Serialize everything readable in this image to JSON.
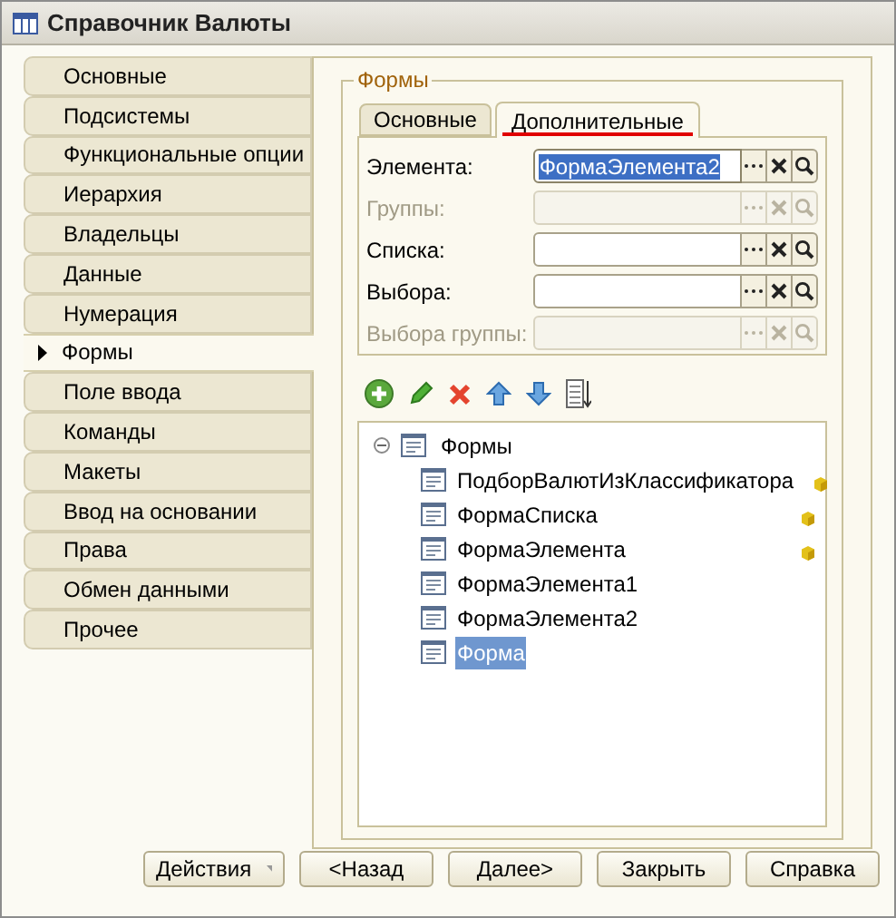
{
  "window": {
    "title": "Справочник Валюты"
  },
  "sections": [
    {
      "label": "Основные",
      "selected": false
    },
    {
      "label": "Подсистемы",
      "selected": false
    },
    {
      "label": "Функциональные опции",
      "selected": false
    },
    {
      "label": "Иерархия",
      "selected": false
    },
    {
      "label": "Владельцы",
      "selected": false
    },
    {
      "label": "Данные",
      "selected": false
    },
    {
      "label": "Нумерация",
      "selected": false
    },
    {
      "label": "Формы",
      "selected": true
    },
    {
      "label": "Поле ввода",
      "selected": false
    },
    {
      "label": "Команды",
      "selected": false
    },
    {
      "label": "Макеты",
      "selected": false
    },
    {
      "label": "Ввод на основании",
      "selected": false
    },
    {
      "label": "Права",
      "selected": false
    },
    {
      "label": "Обмен данными",
      "selected": false
    },
    {
      "label": "Прочее",
      "selected": false
    }
  ],
  "group": {
    "title": "Формы",
    "tabs": [
      {
        "label": "Основные",
        "selected": false
      },
      {
        "label": "Дополнительные",
        "selected": true
      }
    ],
    "fields": [
      {
        "label": "Элемента:",
        "value": "ФормаЭлемента2",
        "disabled": false,
        "selected": true
      },
      {
        "label": "Группы:",
        "disabled": true,
        "selected": false
      },
      {
        "label": "Списка:",
        "disabled": false,
        "selected": false
      },
      {
        "label": "Выбора:",
        "disabled": false,
        "selected": false
      },
      {
        "label": "Выбора группы:",
        "disabled": true,
        "selected": false
      }
    ],
    "tree": {
      "label": "Формы",
      "expanded": true,
      "children": [
        {
          "label": "ПодборВалютИзКлассификатора",
          "marked": true,
          "selected": false
        },
        {
          "label": "ФормаСписка",
          "marked": true,
          "selected": false
        },
        {
          "label": "ФормаЭлемента",
          "marked": true,
          "selected": false
        },
        {
          "label": "ФормаЭлемента1",
          "marked": false,
          "selected": false
        },
        {
          "label": "ФормаЭлемента2",
          "marked": false,
          "selected": false
        },
        {
          "label": "Форма",
          "marked": false,
          "selected": true
        }
      ]
    }
  },
  "buttons": [
    {
      "label": "Действия",
      "kind": "dropdown"
    },
    {
      "label": "<Назад",
      "kind": "plain"
    },
    {
      "label": "Далее>",
      "kind": "plain"
    },
    {
      "label": "Закрыть",
      "kind": "plain"
    },
    {
      "label": "Справка",
      "kind": "plain"
    }
  ]
}
